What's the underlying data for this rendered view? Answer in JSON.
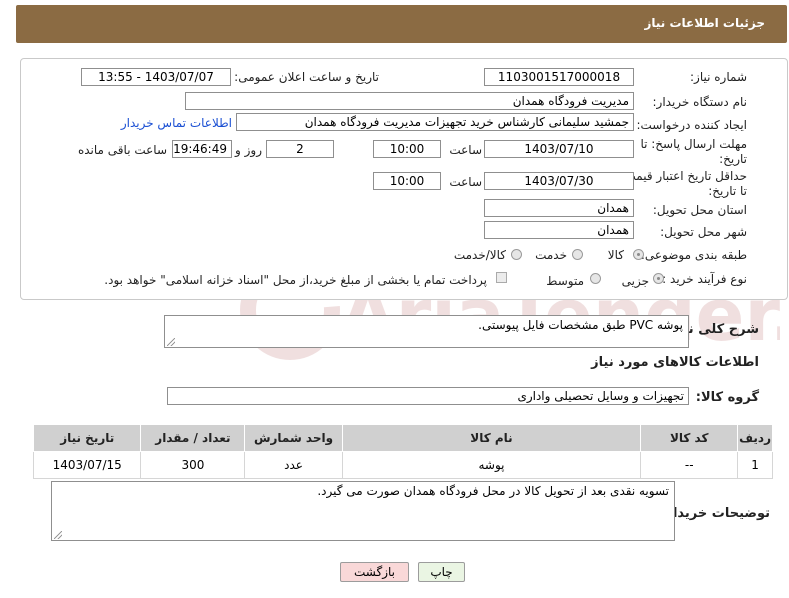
{
  "header": {
    "title": "جزئیات اطلاعات نیاز"
  },
  "form": {
    "need_number": {
      "label": "شماره نیاز:",
      "value": "1103001517000018"
    },
    "announce_datetime": {
      "label": "تاریخ و ساعت اعلان عمومی:",
      "value": "1403/07/07 - 13:55"
    },
    "buyer_org": {
      "label": "نام دستگاه خریدار:",
      "value": "مدیریت فرودگاه همدان"
    },
    "creator": {
      "label": "ایجاد کننده درخواست:",
      "value": "جمشید سلیمانی کارشناس خرید تجهیزات مدیریت فرودگاه همدان",
      "contact_link": "اطلاعات تماس خریدار"
    },
    "reply_deadline": {
      "label": "مهلت ارسال پاسخ: تا تاریخ:",
      "date": "1403/07/10",
      "time_label": "ساعت",
      "time": "10:00",
      "days": "2",
      "days_label": "روز و",
      "remaining": "19:46:49",
      "remaining_label": "ساعت باقی مانده"
    },
    "price_validity": {
      "label": "حداقل تاریخ اعتبار قیمت: تا تاریخ:",
      "date": "1403/07/30",
      "time_label": "ساعت",
      "time": "10:00"
    },
    "province": {
      "label": "استان محل تحویل:",
      "value": "همدان"
    },
    "city": {
      "label": "شهر محل تحویل:",
      "value": "همدان"
    },
    "category": {
      "label": "طبقه بندی موضوعی:",
      "options": [
        "کالا",
        "خدمت",
        "کالا/خدمت"
      ]
    },
    "purchase_type": {
      "label": "نوع فرآیند خرید :",
      "options": [
        "جزیی",
        "متوسط"
      ],
      "payment_note": "پرداخت تمام یا بخشی از مبلغ خرید،از محل \"اسناد خزانه اسلامی\" خواهد بود."
    }
  },
  "description": {
    "label": "شرح کلی نیاز:",
    "value": "پوشه PVC طبق مشخصات فایل پیوستی."
  },
  "goods_section": {
    "title": "اطلاعات کالاهای مورد نیاز"
  },
  "goods_group": {
    "label": "گروه کالا:",
    "value": "تجهیزات و وسایل تحصیلی واداری"
  },
  "table": {
    "headers": [
      "ردیف",
      "کد کالا",
      "نام کالا",
      "واحد شمارش",
      "تعداد / مقدار",
      "تاریخ نیاز"
    ],
    "rows": [
      [
        "1",
        "--",
        "پوشه",
        "عدد",
        "300",
        "1403/07/15"
      ]
    ]
  },
  "buyer_notes": {
    "label": "توضیحات خریدار:",
    "value": "تسویه نقدی بعد از تحویل کالا در محل فرودگاه همدان صورت می گیرد."
  },
  "buttons": {
    "print": "چاپ",
    "back": "بازگشت"
  },
  "watermark": {
    "text": "AriaTender.neT"
  },
  "colors": {
    "header_bg": "#8b6b43",
    "link": "#1a4fd3",
    "back_button_bg": "#f9d8d8",
    "print_button_bg": "#eaf5e3"
  }
}
